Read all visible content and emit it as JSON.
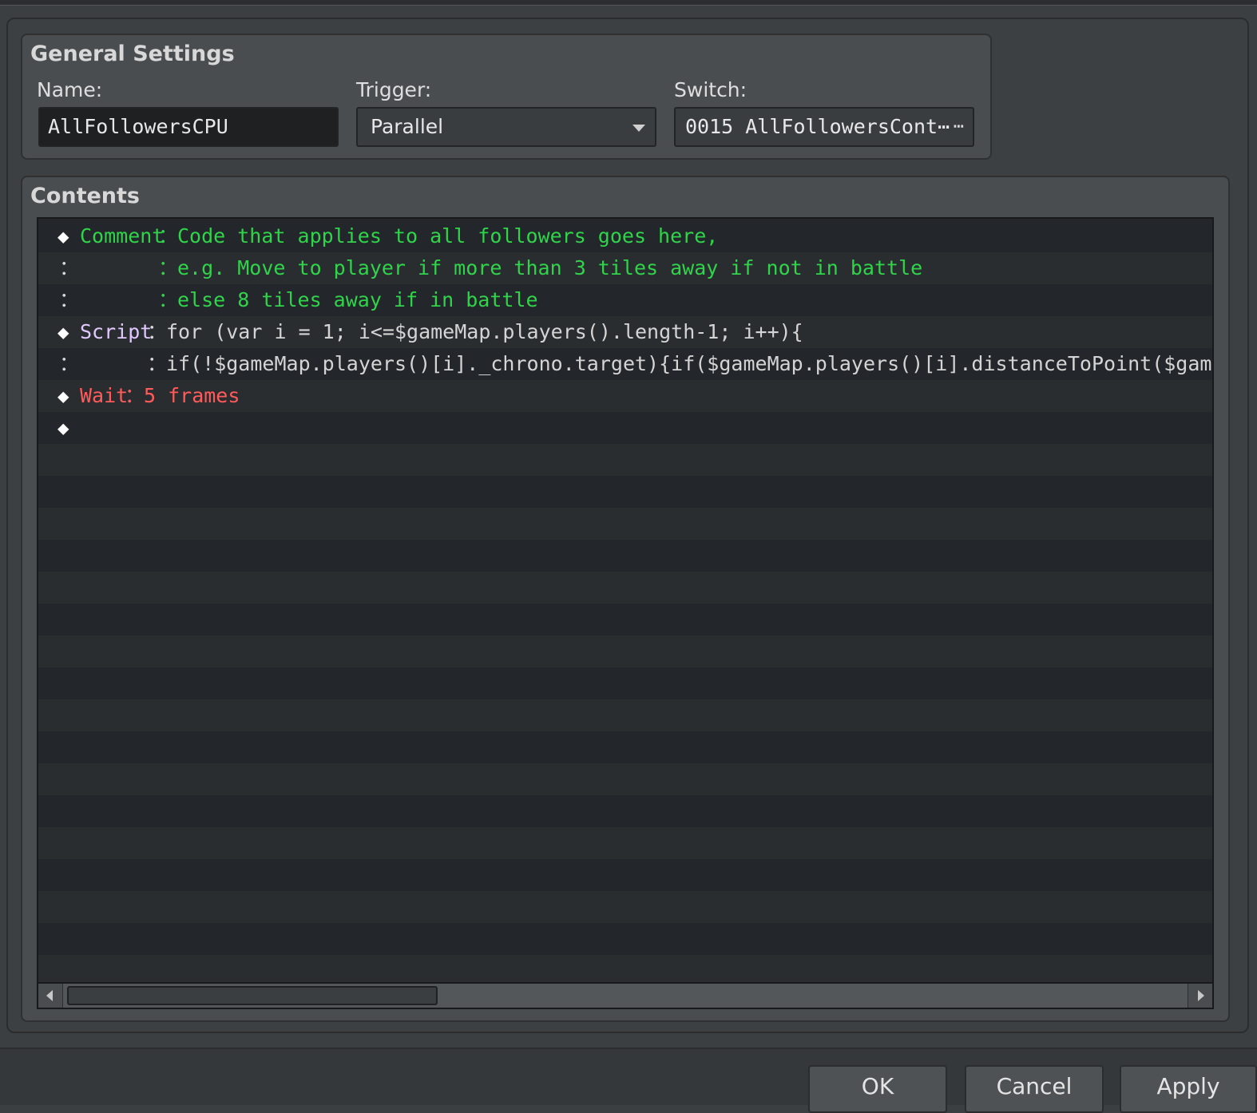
{
  "general": {
    "title": "General Settings",
    "name_label": "Name:",
    "name_value": "AllFollowersCPU",
    "trigger_label": "Trigger:",
    "trigger_value": "Parallel",
    "switch_label": "Switch:",
    "switch_value": "0015 AllFollowersCont⋯",
    "switch_button": "⋯"
  },
  "contents": {
    "title": "Contents",
    "rows": [
      {
        "bullet": "◆",
        "keyword": "Comment",
        "sep": "：",
        "text": "Code that applies to all followers goes here,"
      },
      {
        "bullet": "：",
        "keyword": "",
        "sep": "：",
        "text": "e.g. Move to player if more than 3 tiles away if not in battle"
      },
      {
        "bullet": "：",
        "keyword": "",
        "sep": "：",
        "text": "else 8 tiles away if in battle"
      },
      {
        "bullet": "◆",
        "keyword": "Script",
        "sep": "：",
        "text": "for (var i = 1; i<=$gameMap.players().length-1; i++){"
      },
      {
        "bullet": "：",
        "keyword": "",
        "sep": "：",
        "text": "if(!$gameMap.players()[i]._chrono.target){if($gameMap.players()[i].distanceToPoint($gamePlayer.x,"
      },
      {
        "bullet": "◆",
        "keyword": "Wait",
        "sep": "：",
        "text": "5 frames"
      },
      {
        "bullet": "◆",
        "keyword": "",
        "sep": "",
        "text": ""
      }
    ]
  },
  "buttons": {
    "ok": "OK",
    "cancel": "Cancel",
    "apply": "Apply"
  },
  "colors": {
    "comment": "#2fd44a",
    "wait": "#ff5b5b",
    "script": "#e0c8ff"
  }
}
